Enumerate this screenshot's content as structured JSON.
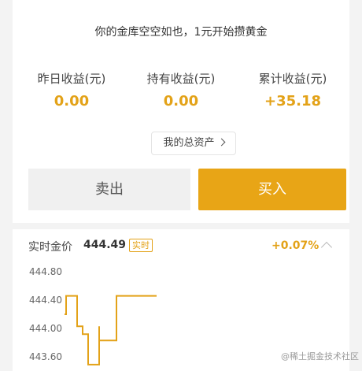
{
  "header": {
    "slogan": "你的金库空空如也，1元开始攒黄金"
  },
  "stats": [
    {
      "label": "昨日收益(元)",
      "value": "0.00"
    },
    {
      "label": "持有收益(元)",
      "value": "0.00"
    },
    {
      "label": "累计收益(元)",
      "value": "+35.18"
    }
  ],
  "assets_button": {
    "label": "我的总资产"
  },
  "actions": {
    "sell_label": "卖出",
    "buy_label": "买入"
  },
  "price": {
    "label": "实时金价",
    "value": "444.49",
    "badge": "实时",
    "change": "+0.07%"
  },
  "colors": {
    "accent": "#e8a516",
    "price_text": "#e3a218"
  },
  "watermark": "@稀土掘金技术社区",
  "chart_data": {
    "type": "line",
    "title": "",
    "xlabel": "",
    "ylabel": "",
    "y_ticks": [
      "444.80",
      "444.40",
      "444.00",
      "443.60"
    ],
    "ylim": [
      443.5,
      444.9
    ],
    "x": [
      0,
      1,
      2,
      3,
      4,
      5,
      6,
      7,
      8,
      9,
      10,
      11,
      12,
      13,
      14,
      15,
      16,
      17,
      18,
      19,
      20
    ],
    "values": [
      444.2,
      444.46,
      444.46,
      444.46,
      444.46,
      444.03,
      444.03,
      443.92,
      443.92,
      443.49,
      443.49,
      444.03,
      443.83,
      443.83,
      443.83,
      443.83,
      444.46,
      444.46,
      444.46,
      444.46,
      444.46
    ],
    "grid": false,
    "legend": "none"
  }
}
